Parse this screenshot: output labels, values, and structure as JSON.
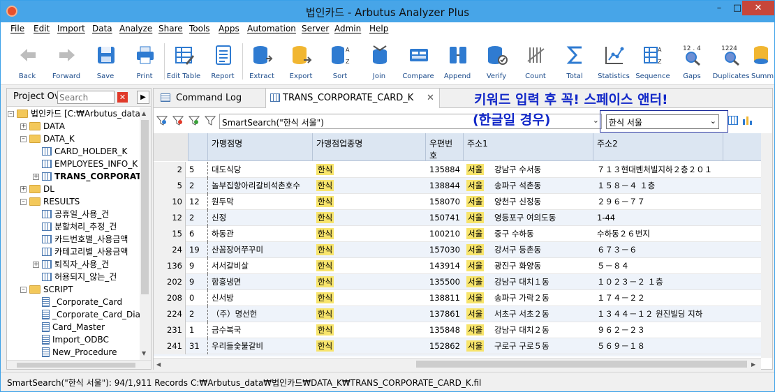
{
  "window": {
    "title": "법인카드 - Arbutus Analyzer Plus",
    "minimize": "–",
    "maximize": "□",
    "close": "✕"
  },
  "menu": [
    "File",
    "Edit",
    "Import",
    "Data",
    "Analyze",
    "Share",
    "Tools",
    "Apps",
    "Automation",
    "Server",
    "Admin",
    "Help"
  ],
  "toolbar": [
    {
      "label": "Back",
      "icon": "back-arrow-icon"
    },
    {
      "label": "Forward",
      "icon": "forward-arrow-icon"
    },
    {
      "label": "Save",
      "icon": "save-icon"
    },
    {
      "label": "Print",
      "icon": "print-icon"
    },
    {
      "label": "Edit Table",
      "icon": "edit-table-icon"
    },
    {
      "label": "Report",
      "icon": "report-icon"
    },
    {
      "label": "Extract",
      "icon": "extract-icon"
    },
    {
      "label": "Export",
      "icon": "export-icon"
    },
    {
      "label": "Sort",
      "icon": "sort-icon"
    },
    {
      "label": "Join",
      "icon": "join-icon"
    },
    {
      "label": "Compare",
      "icon": "compare-icon"
    },
    {
      "label": "Append",
      "icon": "append-icon"
    },
    {
      "label": "Verify",
      "icon": "verify-icon"
    },
    {
      "label": "Count",
      "icon": "count-icon"
    },
    {
      "label": "Total",
      "icon": "sigma-icon"
    },
    {
      "label": "Statistics",
      "icon": "statistics-icon"
    },
    {
      "label": "Sequence",
      "icon": "sequence-icon"
    },
    {
      "label": "Gaps",
      "icon": "gaps-icon"
    },
    {
      "label": "Duplicates",
      "icon": "duplicates-icon"
    },
    {
      "label": "Summ",
      "icon": "summarize-icon"
    }
  ],
  "project": {
    "title": "Project Ov",
    "search_placeholder": "Search",
    "tree": [
      {
        "label": "법인카드 [C:₩Arbutus_data₩",
        "type": "folder",
        "level": 0,
        "expander": "–"
      },
      {
        "label": "DATA",
        "type": "folder",
        "level": 1,
        "expander": "+"
      },
      {
        "label": "DATA_K",
        "type": "folder",
        "level": 1,
        "expander": "–"
      },
      {
        "label": "CARD_HOLDER_K",
        "type": "table",
        "level": 2,
        "expander": ""
      },
      {
        "label": "EMPLOYEES_INFO_K",
        "type": "table",
        "level": 2,
        "expander": ""
      },
      {
        "label": "TRANS_CORPORAT",
        "type": "table",
        "level": 2,
        "expander": "+",
        "bold": true
      },
      {
        "label": "DL",
        "type": "folder",
        "level": 1,
        "expander": "+"
      },
      {
        "label": "RESULTS",
        "type": "folder",
        "level": 1,
        "expander": "–"
      },
      {
        "label": "공휴일_사용_건",
        "type": "table",
        "level": 2,
        "expander": ""
      },
      {
        "label": "분할처리_추정_건",
        "type": "table",
        "level": 2,
        "expander": ""
      },
      {
        "label": "카드번호별_사용금액",
        "type": "table",
        "level": 2,
        "expander": ""
      },
      {
        "label": "카테고리별_사용금액",
        "type": "table",
        "level": 2,
        "expander": ""
      },
      {
        "label": "퇴직자_사용_건",
        "type": "table",
        "level": 2,
        "expander": "+"
      },
      {
        "label": "허용되지_않는_건",
        "type": "table",
        "level": 2,
        "expander": ""
      },
      {
        "label": "SCRIPT",
        "type": "folder",
        "level": 1,
        "expander": "–"
      },
      {
        "label": "_Corporate_Card",
        "type": "script",
        "level": 2,
        "expander": ""
      },
      {
        "label": "_Corporate_Card_Dia",
        "type": "script",
        "level": 2,
        "expander": ""
      },
      {
        "label": "Card_Master",
        "type": "script",
        "level": 2,
        "expander": ""
      },
      {
        "label": "Import_ODBC",
        "type": "script",
        "level": 2,
        "expander": ""
      },
      {
        "label": "New_Procedure",
        "type": "script",
        "level": 2,
        "expander": ""
      }
    ]
  },
  "tabs": [
    {
      "label": "Command Log",
      "active": false
    },
    {
      "label": "TRANS_CORPORATE_CARD_K",
      "active": true
    }
  ],
  "filter": {
    "expression": "SmartSearch(\"한식 서울\")",
    "search_value": "한식 서울"
  },
  "annotation": {
    "line1": "키워드 입력 후 꼭! 스페이스 앤터!",
    "line2": "(한글일 경우)"
  },
  "grid": {
    "columns": [
      "",
      "가맹점명",
      "가맹점업종명",
      "우편번호",
      "주소1",
      "주소2"
    ],
    "rows": [
      {
        "rec": "2",
        "c0": "5",
        "name": "대도식당",
        "type": "한식",
        "zip": "135884",
        "city": "서울",
        "addr1": " 강남구  수서동",
        "addr2": "７１３현대벤처빌지하２층２０１"
      },
      {
        "rec": "5",
        "c0": "2",
        "name": "놀부집항아리갈비석촌호수",
        "type": "한식",
        "zip": "138844",
        "city": "서울",
        "addr1": " 송파구  석촌동",
        "addr2": "１５８－４  １층"
      },
      {
        "rec": "10",
        "c0": "12",
        "name": "원두막",
        "type": "한식",
        "zip": "158070",
        "city": "서울",
        "addr1": " 양천구  신정동",
        "addr2": "２９６－７７"
      },
      {
        "rec": "12",
        "c0": "2",
        "name": "신정",
        "type": "한식",
        "zip": "150741",
        "city": "서울",
        "addr1": " 영등포구  여의도동",
        "addr2": "1-44"
      },
      {
        "rec": "15",
        "c0": "6",
        "name": "하동관",
        "type": "한식",
        "zip": "100210",
        "city": "서울",
        "addr1": " 중구  수하동",
        "addr2": "수하동２６번지"
      },
      {
        "rec": "24",
        "c0": "19",
        "name": "산꼼장어쭈꾸미",
        "type": "한식",
        "zip": "157030",
        "city": "서울",
        "addr1": " 강서구  등촌동",
        "addr2": "６７３－６"
      },
      {
        "rec": "136",
        "c0": "9",
        "name": "서서갈비살",
        "type": "한식",
        "zip": "143914",
        "city": "서울",
        "addr1": " 광진구  화양동",
        "addr2": "５－８４"
      },
      {
        "rec": "202",
        "c0": "9",
        "name": "함흥냉면",
        "type": "한식",
        "zip": "135500",
        "city": "서울",
        "addr1": " 강남구  대치１동",
        "addr2": "１０２３－２  １층"
      },
      {
        "rec": "208",
        "c0": "0",
        "name": "신서방",
        "type": "한식",
        "zip": "138811",
        "city": "서울",
        "addr1": " 송파구  가락２동",
        "addr2": "１７４－２２"
      },
      {
        "rec": "224",
        "c0": "2",
        "name": "（주）명선헌",
        "type": "한식",
        "zip": "137861",
        "city": "서울",
        "addr1": " 서초구  서초２동",
        "addr2": "１３４４－１２  원진빌딩  지하"
      },
      {
        "rec": "231",
        "c0": "1",
        "name": "금수복국",
        "type": "한식",
        "zip": "135848",
        "city": "서울",
        "addr1": " 강남구  대치２동",
        "addr2": "９６２－２３"
      },
      {
        "rec": "241",
        "c0": "31",
        "name": "우리들숯불갈비",
        "type": "한식",
        "zip": "152862",
        "city": "서울",
        "addr1": " 구로구  구로５동",
        "addr2": "５６９－１８"
      }
    ]
  },
  "status": {
    "count": "SmartSearch(\"한식 서울\"): 94/1,911 Records",
    "path": "C:₩Arbutus_data₩법인카드₩DATA_K₩TRANS_CORPORATE_CARD_K.fil"
  },
  "colors": {
    "titlebar": "#47a5e8",
    "annotation": "#1228c8",
    "highlight": "#f7e46b",
    "header": "#dce6f2"
  }
}
